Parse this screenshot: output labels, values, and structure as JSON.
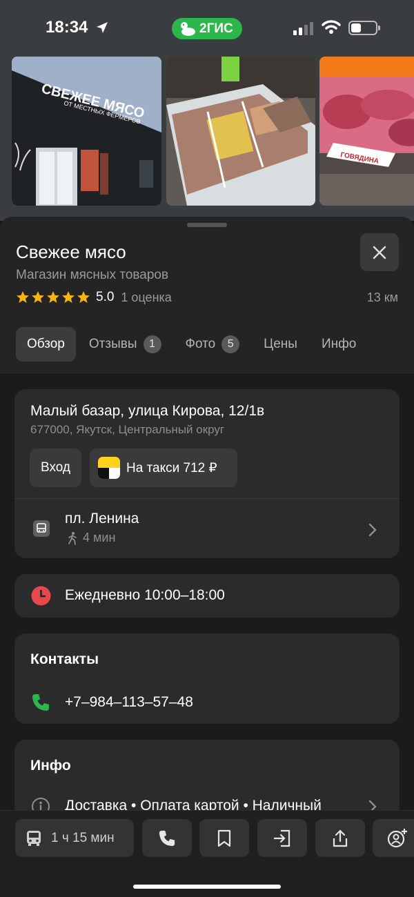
{
  "status_bar": {
    "time": "18:34",
    "app_name": "2ГИС",
    "brand_color": "#2db64c"
  },
  "photos": [
    {
      "icon": "storefront-photo",
      "sign_line_1": "СВЕЖЕЕ МЯСО",
      "sign_line_2": "ОТ МЕСТНЫХ ФЕРМЕРОВ"
    },
    {
      "icon": "freezer-photo"
    },
    {
      "icon": "meat-counter-photo",
      "label": "ГОВЯДИНА"
    }
  ],
  "place": {
    "title": "Свежее мясо",
    "subtitle": "Магазин мясных товаров",
    "rating": "5.0",
    "rating_count": "1 оценка",
    "distance": "13 км"
  },
  "tabs": [
    {
      "label": "Обзор",
      "active": true
    },
    {
      "label": "Отзывы",
      "badge": "1"
    },
    {
      "label": "Фото",
      "badge": "5"
    },
    {
      "label": "Цены"
    },
    {
      "label": "Инфо"
    }
  ],
  "address": {
    "line": "Малый базар, улица Кирова, 12/1в",
    "sub": "677000, Якутск, Центральный округ",
    "entry_label": "Вход",
    "taxi_label": "На такси 712 ₽"
  },
  "transit": {
    "stop": "пл. Ленина",
    "walk_time": "4 мин"
  },
  "hours": {
    "text": "Ежедневно 10:00–18:00",
    "icon_color": "#e5484d"
  },
  "contacts": {
    "title": "Контакты",
    "phone": "+7‒984‒113‒57‒48",
    "icon_color": "#2db64c"
  },
  "info": {
    "title": "Инфо",
    "text": "Доставка • Оплата картой • Наличный"
  },
  "bottom_bar": {
    "route_label": "1 ч 15 мин"
  }
}
